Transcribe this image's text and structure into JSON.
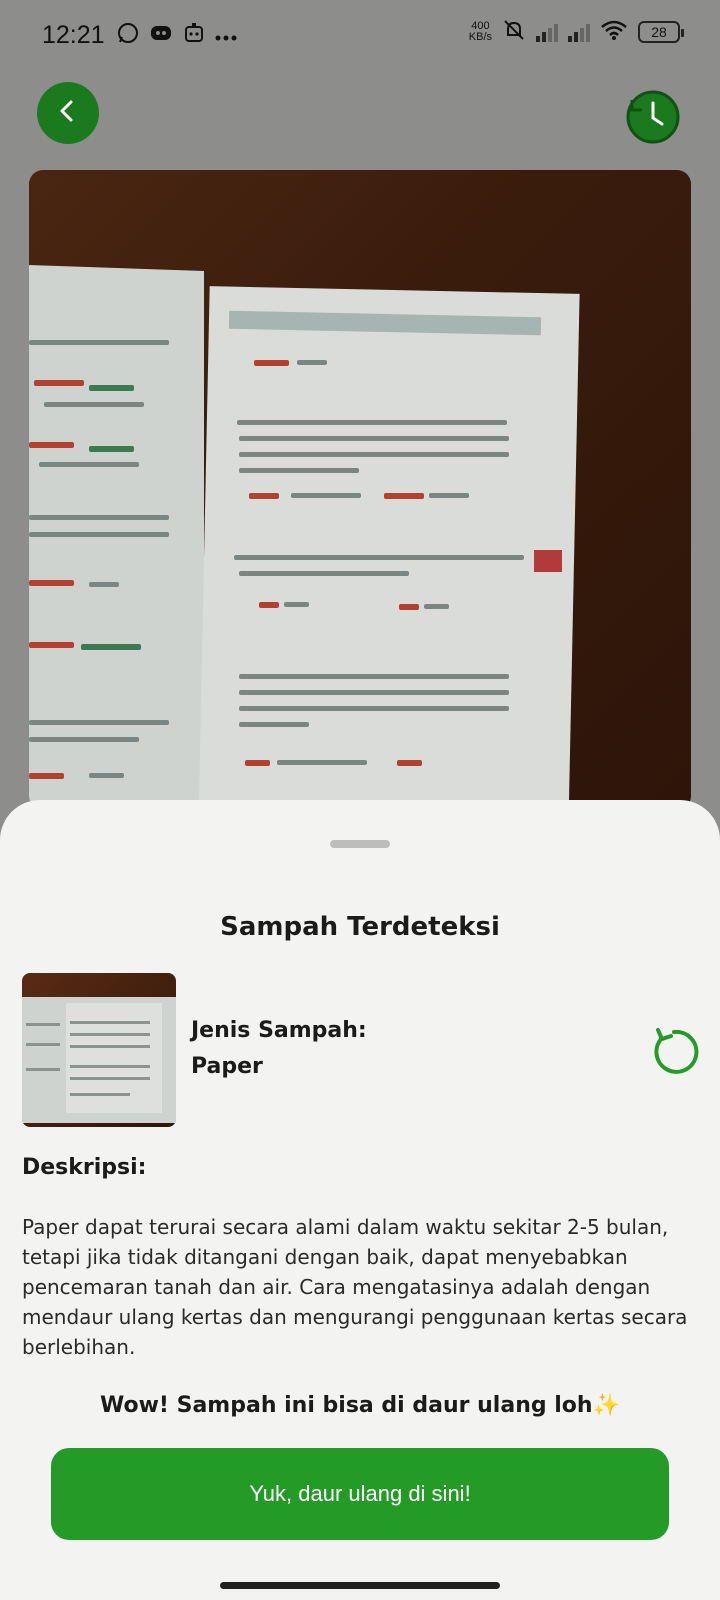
{
  "status_bar": {
    "time": "12:21",
    "left_icons": [
      "whatsapp-icon",
      "discord-icon",
      "bot-icon",
      "more-dots-icon"
    ],
    "net_speed_value": "400",
    "net_speed_unit": "KB/s",
    "right_icons": [
      "silent-icon",
      "signal-icon",
      "signal-icon",
      "wifi-icon"
    ],
    "battery": "28"
  },
  "header": {
    "back_icon": "chevron-left-icon",
    "history_icon": "history-clock-icon",
    "accent_color": "#1c7a1e"
  },
  "sheet": {
    "title": "Sampah Terdeteksi",
    "type_label": "Jenis Sampah:",
    "type_value": "Paper",
    "refresh_icon": "refresh-icon",
    "description_heading": "Deskripsi:",
    "description": "Paper dapat terurai secara alami dalam waktu sekitar 2-5 bulan, tetapi jika tidak ditangani dengan baik, dapat menyebabkan pencemaran tanah dan air. Cara mengatasinya adalah dengan mendaur ulang kertas dan mengurangi penggunaan kertas secara berlebihan.",
    "recycle_note": "Wow! Sampah ini bisa di daur ulang loh✨",
    "cta_label": "Yuk, daur ulang di sini!",
    "cta_color": "#259b27"
  }
}
